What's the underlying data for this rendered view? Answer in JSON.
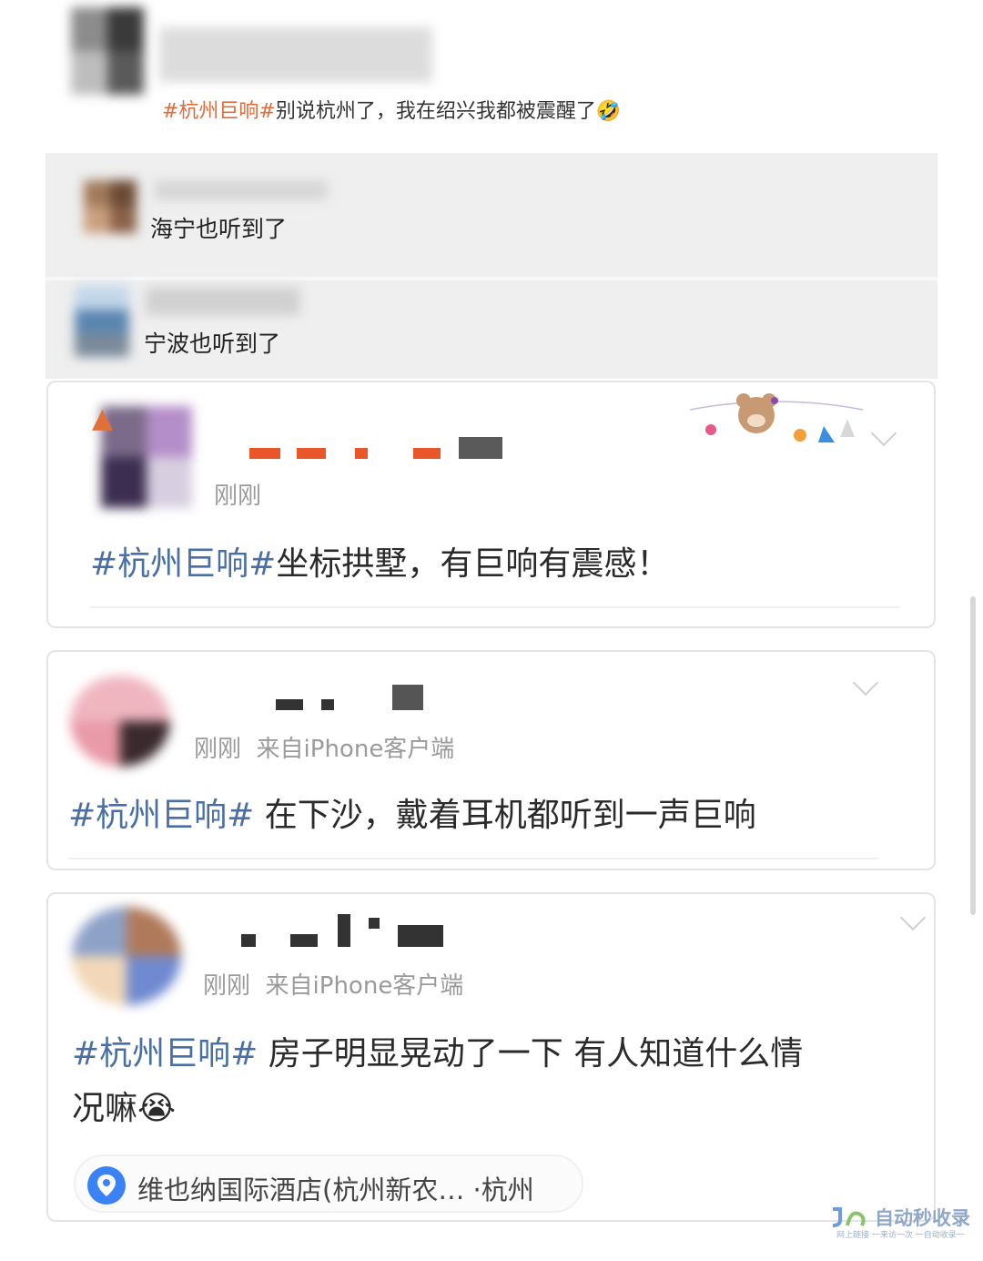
{
  "posts": {
    "top": {
      "hashtag": "#杭州巨响#",
      "text": "别说杭州了，我在绍兴我都被震醒了",
      "emoji": "🤣"
    },
    "replies": [
      {
        "text": "海宁也听到了"
      },
      {
        "text": "宁波也听到了"
      }
    ],
    "card1": {
      "time": "刚刚",
      "hashtag": "#杭州巨响#",
      "text": "坐标拱墅，有巨响有震感！"
    },
    "card2": {
      "time": "刚刚",
      "source": "来自iPhone客户端",
      "hashtag": "#杭州巨响#",
      "text": " 在下沙，戴着耳机都听到一声巨响"
    },
    "card3": {
      "time": "刚刚",
      "source": "来自iPhone客户端",
      "hashtag": "#杭州巨响#",
      "text_line1": " 房子明显晃动了一下 有人知道什么情",
      "text_line2": "况嘛",
      "emoji": "😭",
      "location": "维也纳国际酒店(杭州新农… ·杭州"
    }
  },
  "watermark": {
    "main": "自动秒收录",
    "sub": "网上链接 一来访一次 一自动收录一"
  },
  "colors": {
    "hashtag_blue": "#4a6fa5",
    "hashtag_orange": "#e06c3c",
    "location_pin": "#3b82f6"
  },
  "icons": [
    "chevron-down-icon",
    "location-pin-icon",
    "decoration-bear-icon"
  ]
}
